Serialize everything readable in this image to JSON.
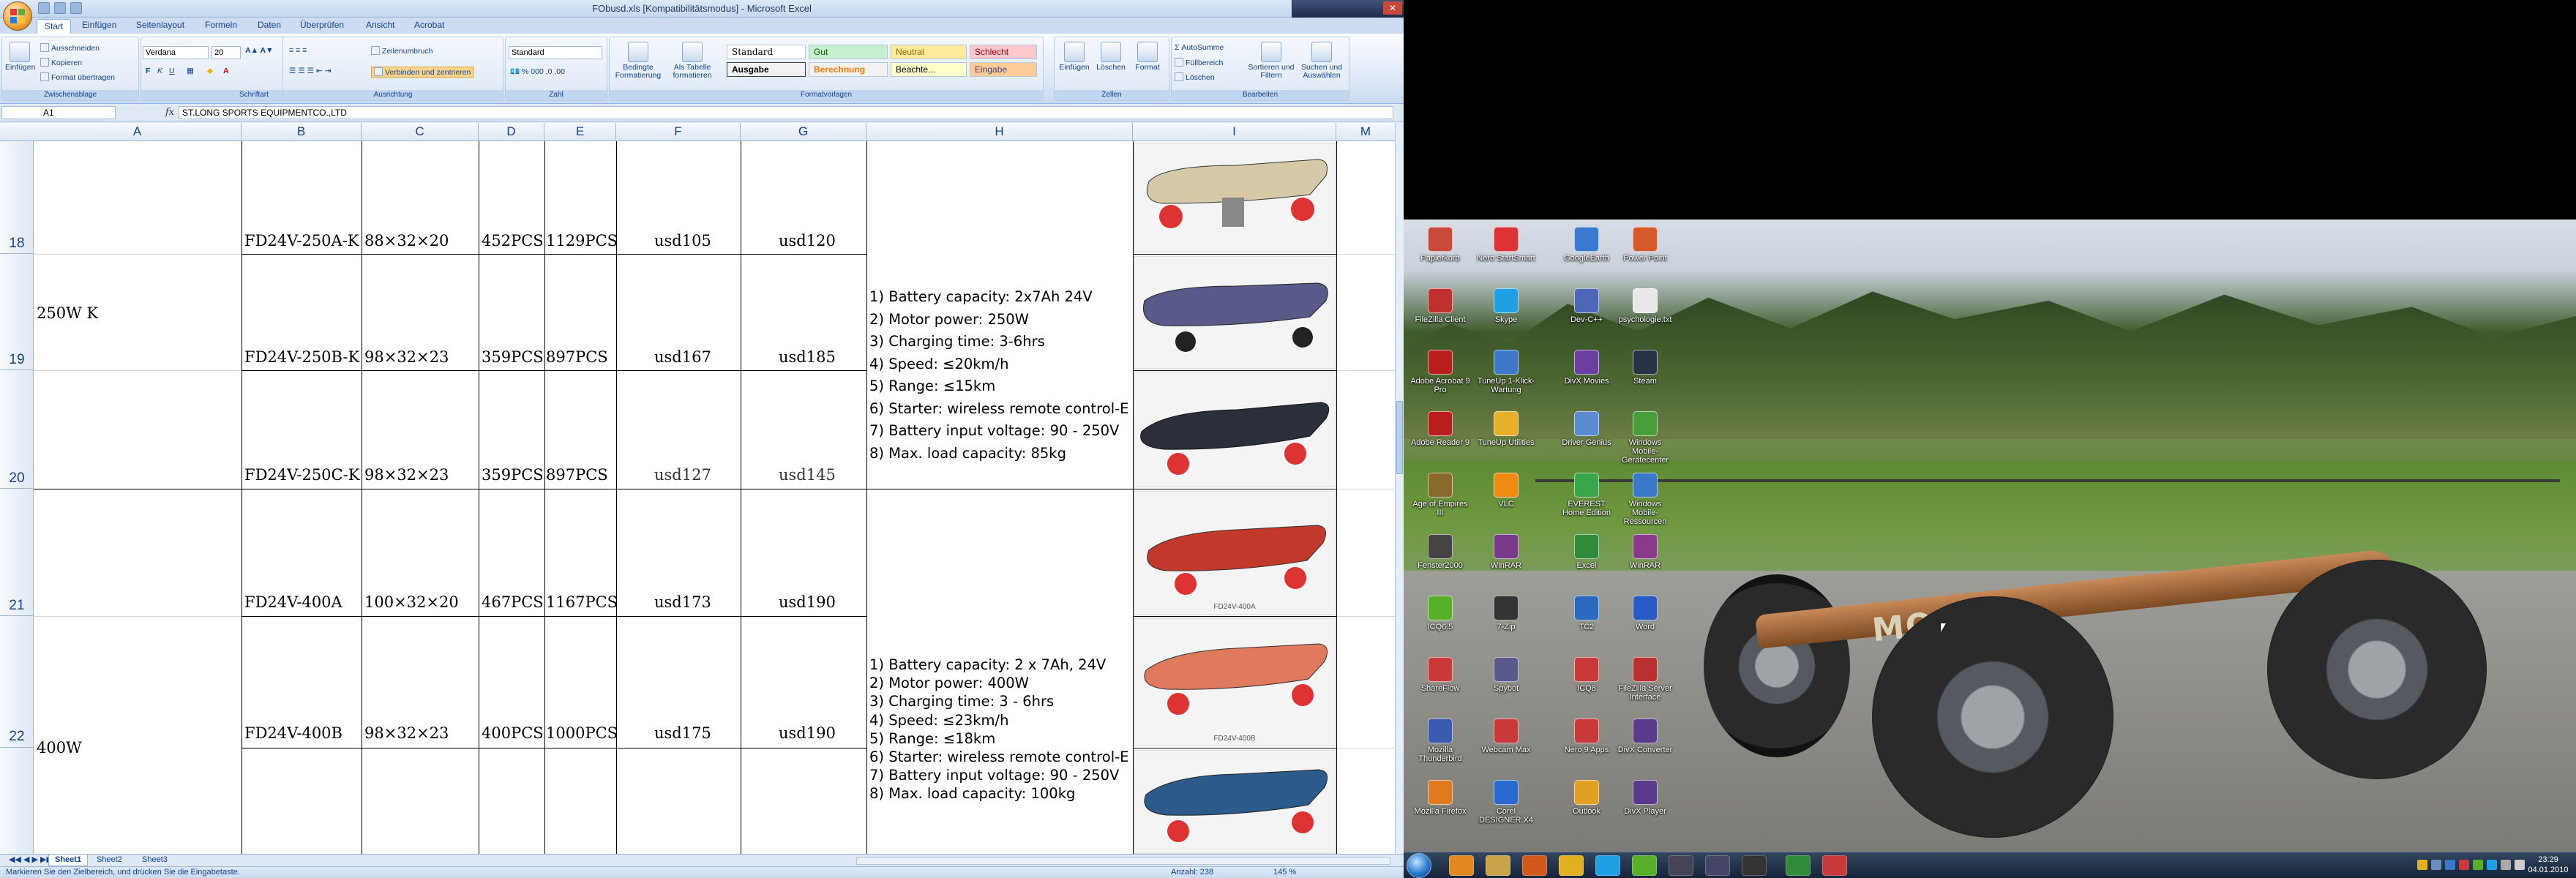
{
  "excel": {
    "title": "FObusd.xls  [Kompatibilitätsmodus]  -  Microsoft Excel",
    "tabs": [
      "Start",
      "Einfügen",
      "Seitenlayout",
      "Formeln",
      "Daten",
      "Überprüfen",
      "Ansicht",
      "Acrobat"
    ],
    "clipboard": {
      "paste": "Einfügen",
      "cut": "Ausschneiden",
      "copy": "Kopieren",
      "format_painter": "Format übertragen",
      "label": "Zwischenablage"
    },
    "font": {
      "name": "Verdana",
      "size": "20",
      "label": "Schriftart"
    },
    "alignment": {
      "wrap": "Zeilenumbruch",
      "merge": "Verbinden und zentrieren",
      "label": "Ausrichtung"
    },
    "number": {
      "format": "Standard",
      "label": "Zahl"
    },
    "styles": {
      "conditional": "Bedingte Formatierung",
      "as_table": "Als Tabelle formatieren",
      "standard": "Standard",
      "gut": "Gut",
      "neutral": "Neutral",
      "schlecht": "Schlecht",
      "ausgabe": "Ausgabe",
      "berechnung": "Berechnung",
      "beachte": "Beachte...",
      "eingabe": "Eingabe",
      "label": "Formatvorlagen"
    },
    "cells": {
      "insert": "Einfügen",
      "delete": "Löschen",
      "format": "Format",
      "label": "Zellen"
    },
    "editing": {
      "autosum": "AutoSumme",
      "fill": "Füllbereich",
      "clear": "Löschen",
      "sort": "Sortieren und Filtern",
      "find": "Suchen und Auswählen",
      "label": "Bearbeiten"
    },
    "namebox": "A1",
    "fx": "fx",
    "formula": "ST.LONG SPORTS EQUIPMENTCO.,LTD",
    "columns": [
      "A",
      "B",
      "C",
      "D",
      "E",
      "F",
      "G",
      "H",
      "I",
      "M"
    ],
    "rows": [
      "18",
      "19",
      "20",
      "21",
      "22"
    ],
    "groups": [
      {
        "label": "250W  K",
        "spec": [
          "1) Battery capacity: 2x7Ah 24V",
          "2) Motor power: 250W",
          "3) Charging time: 3-6hrs",
          "4) Speed: ≤20km/h",
          "5) Range: ≤15km",
          "6) Starter: wireless  remote control-E",
          "7) Battery input voltage: 90 - 250V",
          "8) Max. load capacity: 85kg"
        ]
      },
      {
        "label": "400W",
        "spec": [
          "1) Battery capacity: 2 x 7Ah, 24V",
          "2) Motor power: 400W",
          "3) Charging time: 3 - 6hrs",
          "4) Speed: ≤23km/h",
          "5) Range: ≤18km",
          "6) Starter: wireless remote control-E",
          "7) Battery input voltage: 90 - 250V",
          "8) Max. load capacity: 100kg"
        ]
      }
    ],
    "table": [
      {
        "model": "FD24V-250A-K",
        "size": "88×32×20",
        "d": "452PCS",
        "e": "1129PCS",
        "f": "usd105",
        "g": "usd120"
      },
      {
        "model": "FD24V-250B-K",
        "size": "98×32×23",
        "d": "359PCS",
        "e": "897PCS",
        "f": "usd167",
        "g": "usd185"
      },
      {
        "model": "FD24V-250C-K",
        "size": "98×32×23",
        "d": "359PCS",
        "e": "897PCS",
        "f": "usd127",
        "g": "usd145"
      },
      {
        "model": "FD24V-400A",
        "size": "100×32×20",
        "d": "467PCS",
        "e": "1167PCS",
        "f": "usd173",
        "g": "usd190"
      },
      {
        "model": "FD24V-400B",
        "size": "98×32×23",
        "d": "400PCS",
        "e": "1000PCS",
        "f": "usd175",
        "g": "usd190"
      }
    ],
    "image_captions": [
      "",
      "",
      "",
      "FD24V-400A",
      "FD24V-400B",
      ""
    ],
    "sheets": [
      "Sheet1",
      "Sheet2",
      "Sheet3"
    ],
    "status_left": "Markieren Sie den Zielbereich, und drücken Sie die Eingabetaste.",
    "status_count": "Anzahl: 238",
    "zoom": "145 %"
  },
  "desktop": {
    "icons": [
      {
        "label": "Papierkorb",
        "color": "#c94a3a"
      },
      {
        "label": "Nero StartSmart",
        "color": "#d33"
      },
      {
        "label": "GoogleEarth",
        "color": "#3a7ad0"
      },
      {
        "label": "Power Point",
        "color": "#d65a2a"
      },
      {
        "label": "FileZilla Client",
        "color": "#c03030"
      },
      {
        "label": "Skype",
        "color": "#1fa0e3"
      },
      {
        "label": "Dev-C++",
        "color": "#4d67b8"
      },
      {
        "label": "psychologie.txt",
        "color": "#e8e8e8"
      },
      {
        "label": "Adobe Acrobat 9 Pro",
        "color": "#b81e1e"
      },
      {
        "label": "TuneUp 1-Klick-Wartung",
        "color": "#3f78c8"
      },
      {
        "label": "DivX Movies",
        "color": "#6b3fa0"
      },
      {
        "label": "Steam",
        "color": "#2a3346"
      },
      {
        "label": "Adobe Reader 9",
        "color": "#b81e1e"
      },
      {
        "label": "TuneUp Utilities",
        "color": "#e6b02a"
      },
      {
        "label": "Driver Genius",
        "color": "#5a8bd0"
      },
      {
        "label": "Windows Mobile-Gerätecenter",
        "color": "#4a9e3a"
      },
      {
        "label": "Age of Empires III",
        "color": "#8a6a2a"
      },
      {
        "label": "VLC",
        "color": "#f08a10"
      },
      {
        "label": "EVEREST Home Edition",
        "color": "#3aa64a"
      },
      {
        "label": "Windows Mobile-Ressourcen",
        "color": "#3a78c8"
      },
      {
        "label": "Fenster2000",
        "color": "#444"
      },
      {
        "label": "WinRAR",
        "color": "#7a3a8a"
      },
      {
        "label": "Excel",
        "color": "#2f8a3a"
      },
      {
        "label": "WinRAR",
        "color": "#8a3a8a"
      },
      {
        "label": "ICQ6.5",
        "color": "#58b02a"
      },
      {
        "label": "7-Zip",
        "color": "#333"
      },
      {
        "label": "TC2",
        "color": "#2a6ac0"
      },
      {
        "label": "Word",
        "color": "#2a5ac8"
      },
      {
        "label": "ShareFlow",
        "color": "#c83a3a"
      },
      {
        "label": "Spybot",
        "color": "#5a5a8a"
      },
      {
        "label": "ICQ8",
        "color": "#c83a3a"
      },
      {
        "label": "FileZilla Server Interface",
        "color": "#b83030"
      },
      {
        "label": "Mozilla Thunderbird",
        "color": "#3a5ab0"
      },
      {
        "label": "Webcam Max",
        "color": "#c83a3a"
      },
      {
        "label": "Nero 9 Apps",
        "color": "#c83a3a"
      },
      {
        "label": "DivX Converter",
        "color": "#5a3a8a"
      },
      {
        "label": "Mozilla Firefox",
        "color": "#e07a20"
      },
      {
        "label": "Corel DESIGNER X4",
        "color": "#2a6ad0"
      },
      {
        "label": "Outlook",
        "color": "#e0a020"
      },
      {
        "label": "DivX Player",
        "color": "#5a3a8a"
      }
    ],
    "board_logo": "MO-BO",
    "clock_time": "23:29",
    "clock_date": "04.01.2010"
  }
}
